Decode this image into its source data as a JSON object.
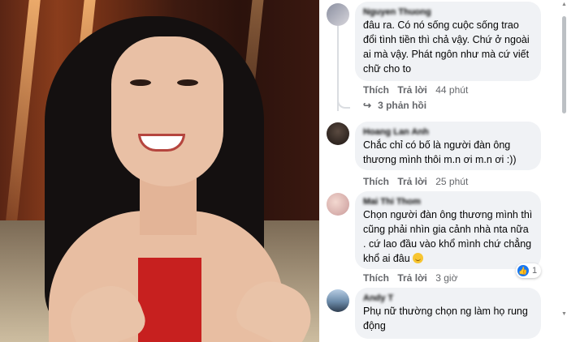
{
  "colors": {
    "bubble_bg": "#f0f2f5",
    "action_text": "#65676b",
    "like_blue": "#1877f2",
    "dress_red": "#c7201f"
  },
  "photo": {
    "description_icon": "woman-smiling-photo-icon"
  },
  "comments": [
    {
      "author": "Nguyen Thuong",
      "text": "đâu ra. Có nó sống cuộc sống trao đổi tình tiền thì chả vậy. Chứ ở ngoài ai mà vậy. Phát ngôn như      mà cứ viết chữ cho to",
      "like_label": "Thích",
      "reply_label": "Trả lời",
      "time": "44 phút",
      "replies_label": "3 phản hồi"
    },
    {
      "author": "Hoang Lan Anh",
      "text": "Chắc chỉ có bố là người đàn ông thương mình thôi m.n ơi m.n ơi :))",
      "like_label": "Thích",
      "reply_label": "Trả lời",
      "time": "25 phút"
    },
    {
      "author": "Mai Thi Thom",
      "text": "Chọn người đàn ông thương mình thì cũng phải nhìn gia cảnh nhà nta nữa . cứ lao đầu vào khổ mình chứ chẳng khổ ai đâu",
      "like_label": "Thích",
      "reply_label": "Trả lời",
      "time": "3 giờ",
      "reaction_count": "1"
    },
    {
      "author": "Andy T",
      "text": "Phụ nữ thường chọn ng làm họ rung động"
    }
  ]
}
